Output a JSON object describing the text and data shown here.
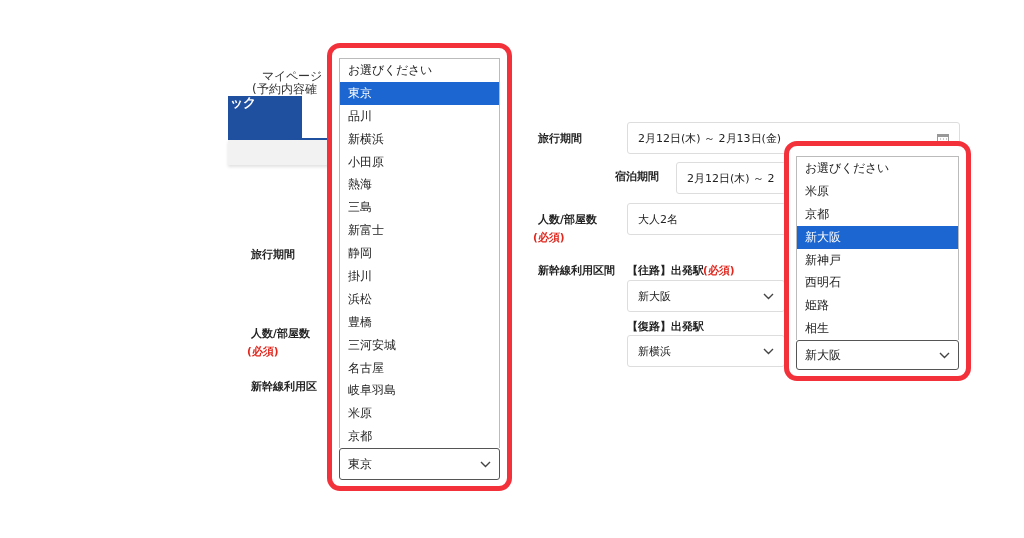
{
  "left_panel": {
    "header": {
      "mypage_label": "マイページ",
      "mypage_sub": "(予約内容確",
      "tab_text": "ック"
    },
    "form_labels": [
      {
        "text": "旅行期間"
      },
      {
        "text": "人数/部屋数",
        "note": "(必須)"
      },
      {
        "text": "新幹線利用区"
      }
    ],
    "dropdown": {
      "options": [
        {
          "label": "お選びください",
          "selected": false
        },
        {
          "label": "東京",
          "selected": true
        },
        {
          "label": "品川",
          "selected": false
        },
        {
          "label": "新横浜",
          "selected": false
        },
        {
          "label": "小田原",
          "selected": false
        },
        {
          "label": "熱海",
          "selected": false
        },
        {
          "label": "三島",
          "selected": false
        },
        {
          "label": "新富士",
          "selected": false
        },
        {
          "label": "静岡",
          "selected": false
        },
        {
          "label": "掛川",
          "selected": false
        },
        {
          "label": "浜松",
          "selected": false
        },
        {
          "label": "豊橋",
          "selected": false
        },
        {
          "label": "三河安城",
          "selected": false
        },
        {
          "label": "名古屋",
          "selected": false
        },
        {
          "label": "岐阜羽島",
          "selected": false
        },
        {
          "label": "米原",
          "selected": false
        },
        {
          "label": "京都",
          "selected": false
        }
      ],
      "value": "東京"
    }
  },
  "right_panel": {
    "travel_period": {
      "label": "旅行期間",
      "value": "2月12日(木) ～  2月13日(金)"
    },
    "stay_period": {
      "label": "宿泊期間",
      "value": "2月12日(木) ～  2"
    },
    "guests": {
      "label": "人数/部屋数",
      "note": "(必須)",
      "value": "大人2名"
    },
    "shinkansen": {
      "label": "新幹線利用区間",
      "outbound": {
        "label": "【往路】出発駅",
        "note": "(必須)",
        "value": "新大阪"
      },
      "return": {
        "label": "【復路】出発駅",
        "value": "新横浜"
      }
    },
    "dropdown": {
      "options": [
        {
          "label": "お選びください",
          "selected": false
        },
        {
          "label": "米原",
          "selected": false
        },
        {
          "label": "京都",
          "selected": false
        },
        {
          "label": "新大阪",
          "selected": true
        },
        {
          "label": "新神戸",
          "selected": false
        },
        {
          "label": "西明石",
          "selected": false
        },
        {
          "label": "姫路",
          "selected": false
        },
        {
          "label": "相生",
          "selected": false
        }
      ],
      "value": "新大阪"
    }
  }
}
